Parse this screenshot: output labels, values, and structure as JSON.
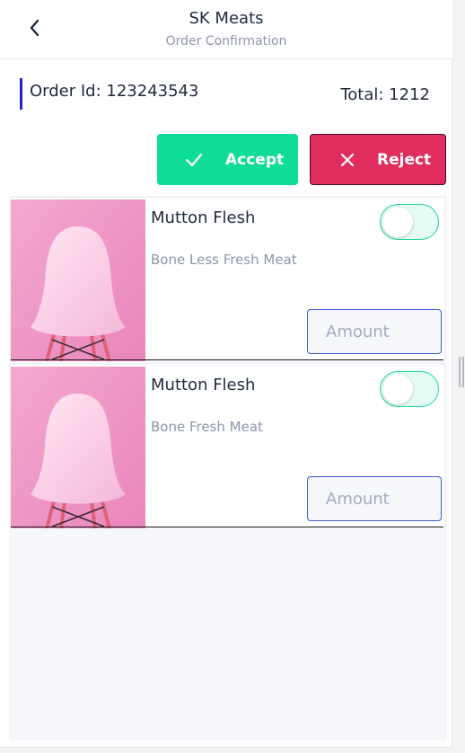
{
  "header": {
    "back_icon": "chevron-left-icon",
    "title": "SK Meats",
    "subtitle": "Order Confirmation"
  },
  "order": {
    "id_text": "Order Id: 123243543",
    "total_text": "Total: 1212",
    "accent_color": "#2525c7"
  },
  "actions": {
    "accept_label": "Accept",
    "accept_icon": "check-icon",
    "accept_color": "#10dc99",
    "reject_label": "Reject",
    "reject_icon": "close-icon",
    "reject_color": "#e02d5e"
  },
  "items": [
    {
      "name": "Mutton Flesh",
      "description": "Bone Less Fresh Meat",
      "image": "pink-chair-photo",
      "toggle_on": false,
      "amount_placeholder": "Amount"
    },
    {
      "name": "Mutton Flesh",
      "description": "Bone Fresh Meat",
      "image": "pink-chair-photo",
      "toggle_on": false,
      "amount_placeholder": "Amount"
    }
  ]
}
